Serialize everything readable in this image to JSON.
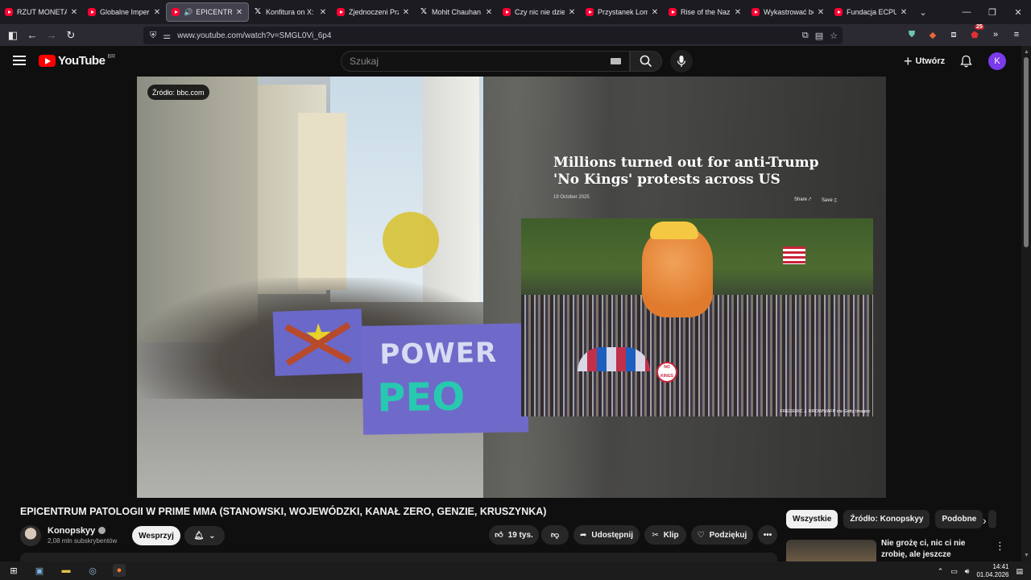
{
  "browser": {
    "tabs": [
      {
        "title": "RZUT MONETĄ DJ",
        "icon": "youtube-icon",
        "active": false
      },
      {
        "title": "Globalne Imperium",
        "icon": "youtube-icon",
        "active": false
      },
      {
        "title": "EPICENTRUM",
        "icon": "youtube-icon",
        "active": true,
        "audio": true
      },
      {
        "title": "Konfitura on X: \"Po",
        "icon": "x-icon",
        "active": false
      },
      {
        "title": "Zjednoczeni Przeciw",
        "icon": "youtube-icon",
        "active": false
      },
      {
        "title": "Mohit Chauhan on",
        "icon": "x-icon",
        "active": false
      },
      {
        "title": "Czy nic nie dzieje si",
        "icon": "youtube-icon",
        "active": false
      },
      {
        "title": "Przystanek Lombard",
        "icon": "youtube-icon",
        "active": false
      },
      {
        "title": "Rise of the Nazis a",
        "icon": "youtube-icon",
        "active": false
      },
      {
        "title": "Wykastrować bezdo",
        "icon": "youtube-icon",
        "active": false
      },
      {
        "title": "Fundacja ECPU Po",
        "icon": "youtube-icon",
        "active": false
      }
    ],
    "url": "www.youtube.com/watch?v=SMGL0Vi_6p4",
    "extension_badge": "25"
  },
  "youtube": {
    "logo_text": "YouTube",
    "country_code": "BR",
    "search_placeholder": "Szukaj",
    "create_label": "Utwórz",
    "avatar_letter": "K"
  },
  "video": {
    "source_label": "Źródło: bbc.com",
    "headline": "Millions turned out for anti-Trump 'No Kings' protests across US",
    "article_date": "19 October 2025",
    "share_label": "Share",
    "save_label": "Save",
    "photo_credit": "FREDERIC J. BROWN/AFP via Getty Images",
    "banner_text_1": "POWER",
    "banner_text_2": "PEO",
    "sign_text": "NO KINGS"
  },
  "details": {
    "title": "EPICENTRUM PATOLOGII W PRIME MMA (STANOWSKI, WOJEWÓDZKI, KANAŁ ZERO, GENZIE, KRUSZYNKA)",
    "channel_name": "Konopskyy",
    "subscribers": "2,08 mln subskrybentów",
    "support_label": "Wesprzyj",
    "likes": "19 tys.",
    "share_label": "Udostępnij",
    "clip_label": "Klip",
    "thanks_label": "Podziękuj"
  },
  "sidebar": {
    "chips": [
      "Wszystkie",
      "Źródło: Konopskyy",
      "Podobne"
    ],
    "recommendation_title": "Nie grożę ci, nic ci nie zrobię, ale jeszcze zobaczysz w ..."
  },
  "taskbar": {
    "time": "14:41",
    "date": "01.04.2026"
  }
}
